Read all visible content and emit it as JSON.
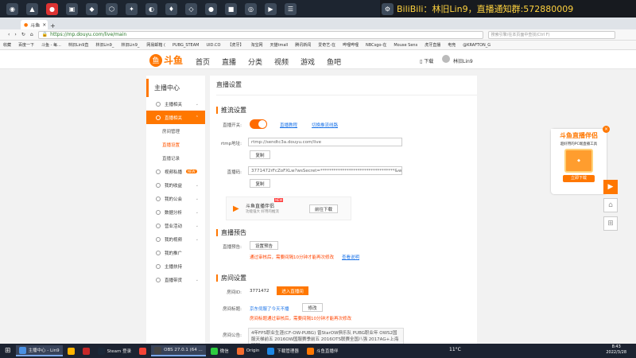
{
  "banner": {
    "text": "BiliBili：林旧Lin9，直播通知群:572880009"
  },
  "browser": {
    "tab_label": "斗鱼",
    "url": "https://mp.douyu.com/live/main",
    "search_placeholder": "搜索引擎/在本页面中查找(Ctrl F)",
    "bookmarks": [
      "收藏",
      "百度一下",
      "斗鱼 - 每...",
      "林旧Lin9直",
      "林旧Lin9_",
      "林旧Lin9_",
      "网易邮箱 (",
      "PUBG_STEAM",
      "UID.CO",
      "【虎牙】",
      "淘宝网",
      "天猫tmall",
      "腾讯新闻",
      "爱奇艺-在",
      "哔哩哔哩",
      "NBCsgo-在",
      "Mouse Sens",
      "虎牙直播",
      "电竞",
      "@KRAFTON_G"
    ]
  },
  "site": {
    "logo": "斗鱼",
    "nav": [
      "首页",
      "直播",
      "分类",
      "视频",
      "游戏",
      "鱼吧"
    ],
    "download": "下载",
    "user": "林旧Lin9"
  },
  "sidebar": {
    "header": "主播中心",
    "items": [
      {
        "label": "主播相关",
        "active": false
      },
      {
        "label": "直播相关",
        "active": true
      },
      {
        "label": "视频私播",
        "active": false,
        "badge": "NEW"
      },
      {
        "label": "我的收益",
        "active": false
      },
      {
        "label": "我的公会",
        "active": false
      },
      {
        "label": "数据分析",
        "active": false
      },
      {
        "label": "营业活动",
        "active": false
      },
      {
        "label": "我的视频",
        "active": false
      },
      {
        "label": "我的推广",
        "active": false
      },
      {
        "label": "主播扶持",
        "active": false
      },
      {
        "label": "直播带货",
        "active": false
      }
    ],
    "subitems": [
      "房间管理",
      "直播设置",
      "直播记录"
    ]
  },
  "main": {
    "title": "直播设置",
    "section_push": "推流设置",
    "switch_label": "直播开关:",
    "link_tutorial": "直播教程",
    "link_pusher": "切换推流线路",
    "rtmp_label": "rtmp地址:",
    "rtmp_value": "rtmp://sendtc3a.douyu.com/live",
    "copy": "复制",
    "code_label": "直播码:",
    "code_value": "3771472rFcZoFXLw?wsSecret=**********************************&wsTime",
    "promo_title": "斗鱼直播伴侣",
    "promo_sub": "功能强大 好用的推流",
    "promo_btn": "前往下载",
    "promo_new": "NEW",
    "section_preview": "直播预告",
    "preview_label": "直播预告:",
    "preview_btn": "设置预告",
    "preview_warn": "通过审核后，需要间隔10分钟才能再次修改",
    "preview_link": "查看说明",
    "section_room": "房间设置",
    "roomid_label": "房间ID:",
    "roomid_value": "3771472",
    "roomid_btn": "进入直播间",
    "roomtitle_label": "房间标题:",
    "roomtitle_value": "京东伺服了今天不播",
    "modify": "修改",
    "roomtitle_warn": "房间标题通过审核后，需要间隔10分钟才能再次修改",
    "notice_label": "房间公告:",
    "notice_value": "4年FPS职业生涯(CF-OW-PUBG) 曾StarOW俱乐队 PUBG职业年 OWS2国服天梯前五 2016OW国服赛季前五 2016OTS联赛全国八强 2017AG+上海冠军 keep running!"
  },
  "float_promo": {
    "title": "斗鱼直播伴侣",
    "sub": "超好用的PC端直播工具",
    "btn": "立即下载"
  },
  "taskbar": {
    "items": [
      {
        "label": "主播中心 - Lin9",
        "active": true
      },
      {
        "label": "",
        "active": false
      },
      {
        "label": "",
        "active": false
      },
      {
        "label": "Steam 登录",
        "active": false
      },
      {
        "label": "",
        "active": false
      },
      {
        "label": "OBS 27.0.1 (64 ...",
        "active": true
      },
      {
        "label": "微信",
        "active": false
      },
      {
        "label": "Origin",
        "active": false
      },
      {
        "label": "下载管理器",
        "active": false
      },
      {
        "label": "斗鱼直播伴",
        "active": false
      }
    ],
    "weather": "11°C",
    "time": "8:43",
    "date": "2022/3/28"
  }
}
